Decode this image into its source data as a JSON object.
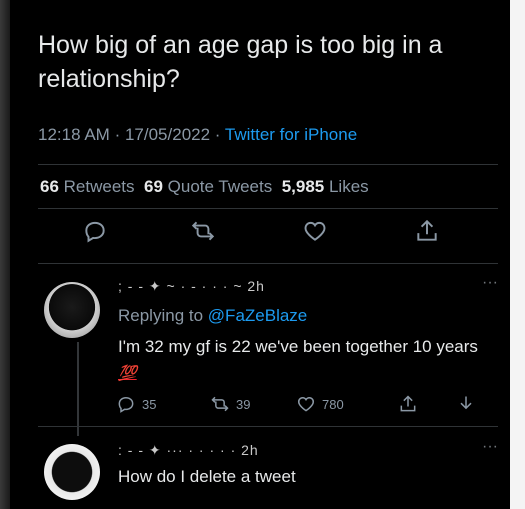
{
  "tweet": {
    "question": "How big of an age gap is too big in a relationship?",
    "time": "12:18 AM",
    "date": "17/05/2022",
    "separator": "·",
    "source": "Twitter for iPhone",
    "retweets_count": "66",
    "retweets_label": "Retweets",
    "quote_count": "69",
    "quote_label": "Quote Tweets",
    "likes_count": "5,985",
    "likes_label": "Likes"
  },
  "icons": {
    "reply": "reply-icon",
    "retweet": "retweet-icon",
    "like": "heart-icon",
    "share": "share-icon",
    "more": "more-icon",
    "download": "download-icon"
  },
  "replies": [
    {
      "name_redacted": "; - - ✦ ~ · - · · · ~ 2h",
      "replying_prefix": "Replying to",
      "replying_handle": "@FaZeBlaze",
      "text": "I'm 32 my gf is 22 we've been together 10 years",
      "emoji": "💯",
      "reply_count": "35",
      "retweet_count": "39",
      "like_count": "780",
      "more": "···"
    },
    {
      "name_redacted": ": - - ✦ ··· · · · · · 2h",
      "text": "How do I delete a tweet",
      "more": "···"
    }
  ],
  "colors": {
    "background": "#000000",
    "primary_text": "#e7e9ea",
    "secondary_text": "#8b98a5",
    "accent": "#1d9bf0"
  }
}
